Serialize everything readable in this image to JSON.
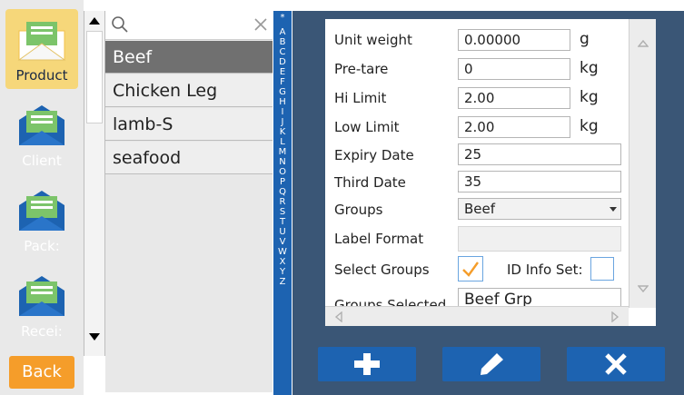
{
  "nav": {
    "items": [
      {
        "label": "Product"
      },
      {
        "label": "Client"
      },
      {
        "label": "Pack:"
      },
      {
        "label": "Recei:"
      }
    ],
    "back_label": "Back"
  },
  "products": [
    {
      "name": "Beef"
    },
    {
      "name": "Chicken Leg"
    },
    {
      "name": "lamb-S"
    },
    {
      "name": "seafood"
    }
  ],
  "alphabet": [
    "*",
    "A",
    "B",
    "C",
    "D",
    "E",
    "F",
    "G",
    "H",
    "I",
    "J",
    "K",
    "L",
    "M",
    "N",
    "O",
    "P",
    "Q",
    "R",
    "S",
    "T",
    "U",
    "V",
    "W",
    "X",
    "Y",
    "Z"
  ],
  "form": {
    "unit_weight": {
      "label": "Unit weight",
      "value": "0.00000",
      "unit": "g"
    },
    "pre_tare": {
      "label": "Pre-tare",
      "value": "0",
      "unit": "kg"
    },
    "hi_limit": {
      "label": "Hi Limit",
      "value": "2.00",
      "unit": "kg"
    },
    "low_limit": {
      "label": "Low Limit",
      "value": "2.00",
      "unit": "kg"
    },
    "expiry_date": {
      "label": "Expiry Date",
      "value": "25"
    },
    "third_date": {
      "label": "Third Date",
      "value": "35"
    },
    "groups": {
      "label": "Groups",
      "value": "Beef"
    },
    "label_format": {
      "label": "Label Format",
      "value": ""
    },
    "select_groups": {
      "label": "Select Groups",
      "checked": true
    },
    "id_info_set": {
      "label": "ID Info Set:",
      "checked": false
    },
    "groups_selected": {
      "label": "Groups Selected",
      "value": "Beef Grp"
    }
  },
  "colors": {
    "accent_blue": "#1d63b1",
    "panel_bg": "#3a5676",
    "back_orange": "#f59d2a",
    "active_nav": "#f6d77a",
    "check_orange": "#f59d2a"
  },
  "icons": {
    "nav": [
      "product-envelope-icon",
      "client-envelope-icon",
      "pack-envelope-icon",
      "receive-envelope-icon"
    ],
    "search": "search-icon",
    "clear": "close-icon",
    "add": "plus-icon",
    "edit": "pencil-icon",
    "delete": "x-icon"
  }
}
